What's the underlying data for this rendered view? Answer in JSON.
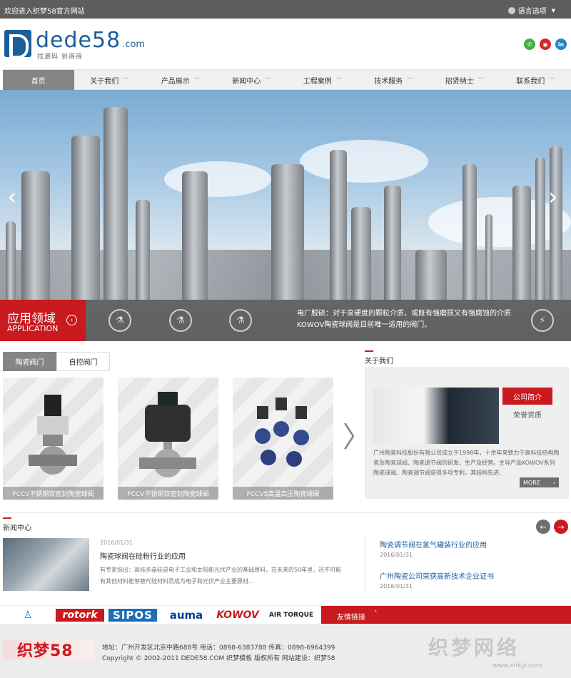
{
  "topbar": {
    "welcome": "欢迎进入织梦58官方网站",
    "language": "语言选项"
  },
  "logo": {
    "text": "dede58",
    "suffix": ".com",
    "slogan": "找源码  到得得"
  },
  "socials": [
    "wechat-icon",
    "weibo-icon",
    "linkedin-icon"
  ],
  "nav": {
    "items": [
      {
        "label": "首页",
        "active": true
      },
      {
        "label": "关于我们"
      },
      {
        "label": "产品展示"
      },
      {
        "label": "新闻中心"
      },
      {
        "label": "工程案例"
      },
      {
        "label": "技术服务"
      },
      {
        "label": "招贤纳士"
      },
      {
        "label": "联系我们"
      }
    ]
  },
  "banner": {
    "prev": "‹",
    "next": "›",
    "app_cn": "应用领域",
    "app_en": "APPLICATION",
    "desc_line1": "电厂脱硫：对于高硬度的颗粒介质，或既有强磨损又有强腐蚀的介质",
    "desc_line2": "KOWOV陶瓷球阀是目前唯一适用的阀门。"
  },
  "products": {
    "tabs": [
      "陶瓷阀门",
      "自控阀门"
    ],
    "items": [
      {
        "caption": "FCCV不锈钢双密封陶瓷球阀"
      },
      {
        "caption": "FCCV不锈钢双密封陶瓷球阀"
      },
      {
        "caption": "FCCV5高温高压陶瓷球阀"
      }
    ],
    "next": "〉"
  },
  "about": {
    "title": "关于我们",
    "tab_active": "公司简介",
    "tab_other": "荣誉资质",
    "text": "广州陶瓷科技股份有限公司成立于1998年，十余年来致力于高科技结构陶瓷及陶瓷球阀、陶瓷调节阀的研发、生产及经营。主导产品KOWOV系列陶瓷球阀、陶瓷调节阀获得多项专利，其结构先进、",
    "more": "MORE"
  },
  "news": {
    "title": "新闻中心",
    "feature": {
      "date": "2016/01/31",
      "title": "陶瓷球阀在硅粉行业的应用",
      "summary": "有专家指出：高纯多晶硅是电子工业和太阳能光伏产业的基础原料，在未来的50年里，还不可能有其他材料能够替代硅材料而成为电子和光伏产业主要原材..."
    },
    "list": [
      {
        "title": "陶瓷调节阀在氯气罐装行业的应用",
        "date": "2016/01/31"
      },
      {
        "title": "广州陶瓷公司荣获高新技术企业证书",
        "date": "2016/01/31"
      }
    ]
  },
  "partners": {
    "logos": [
      "rotork",
      "SIPOS",
      "auma",
      "KOWOV",
      "AIR TORQUE"
    ],
    "links_label": "友情链接",
    "links_toggle": "˄"
  },
  "footer": {
    "logo": "织梦58",
    "address": "地址：广州开发区北京中路688号  电话：0898-6383788  传真：0898-6964399",
    "copyright": "Copyright © 2002-2011 DEDE58.COM 织梦模板 版权所有   网站建设：织梦58",
    "watermark": "织梦网络",
    "watermark_url": "www.xnkjz.com"
  },
  "colors": {
    "accent": "#c81a1f",
    "brand": "#1c5e9f",
    "nav_active": "#858585"
  }
}
